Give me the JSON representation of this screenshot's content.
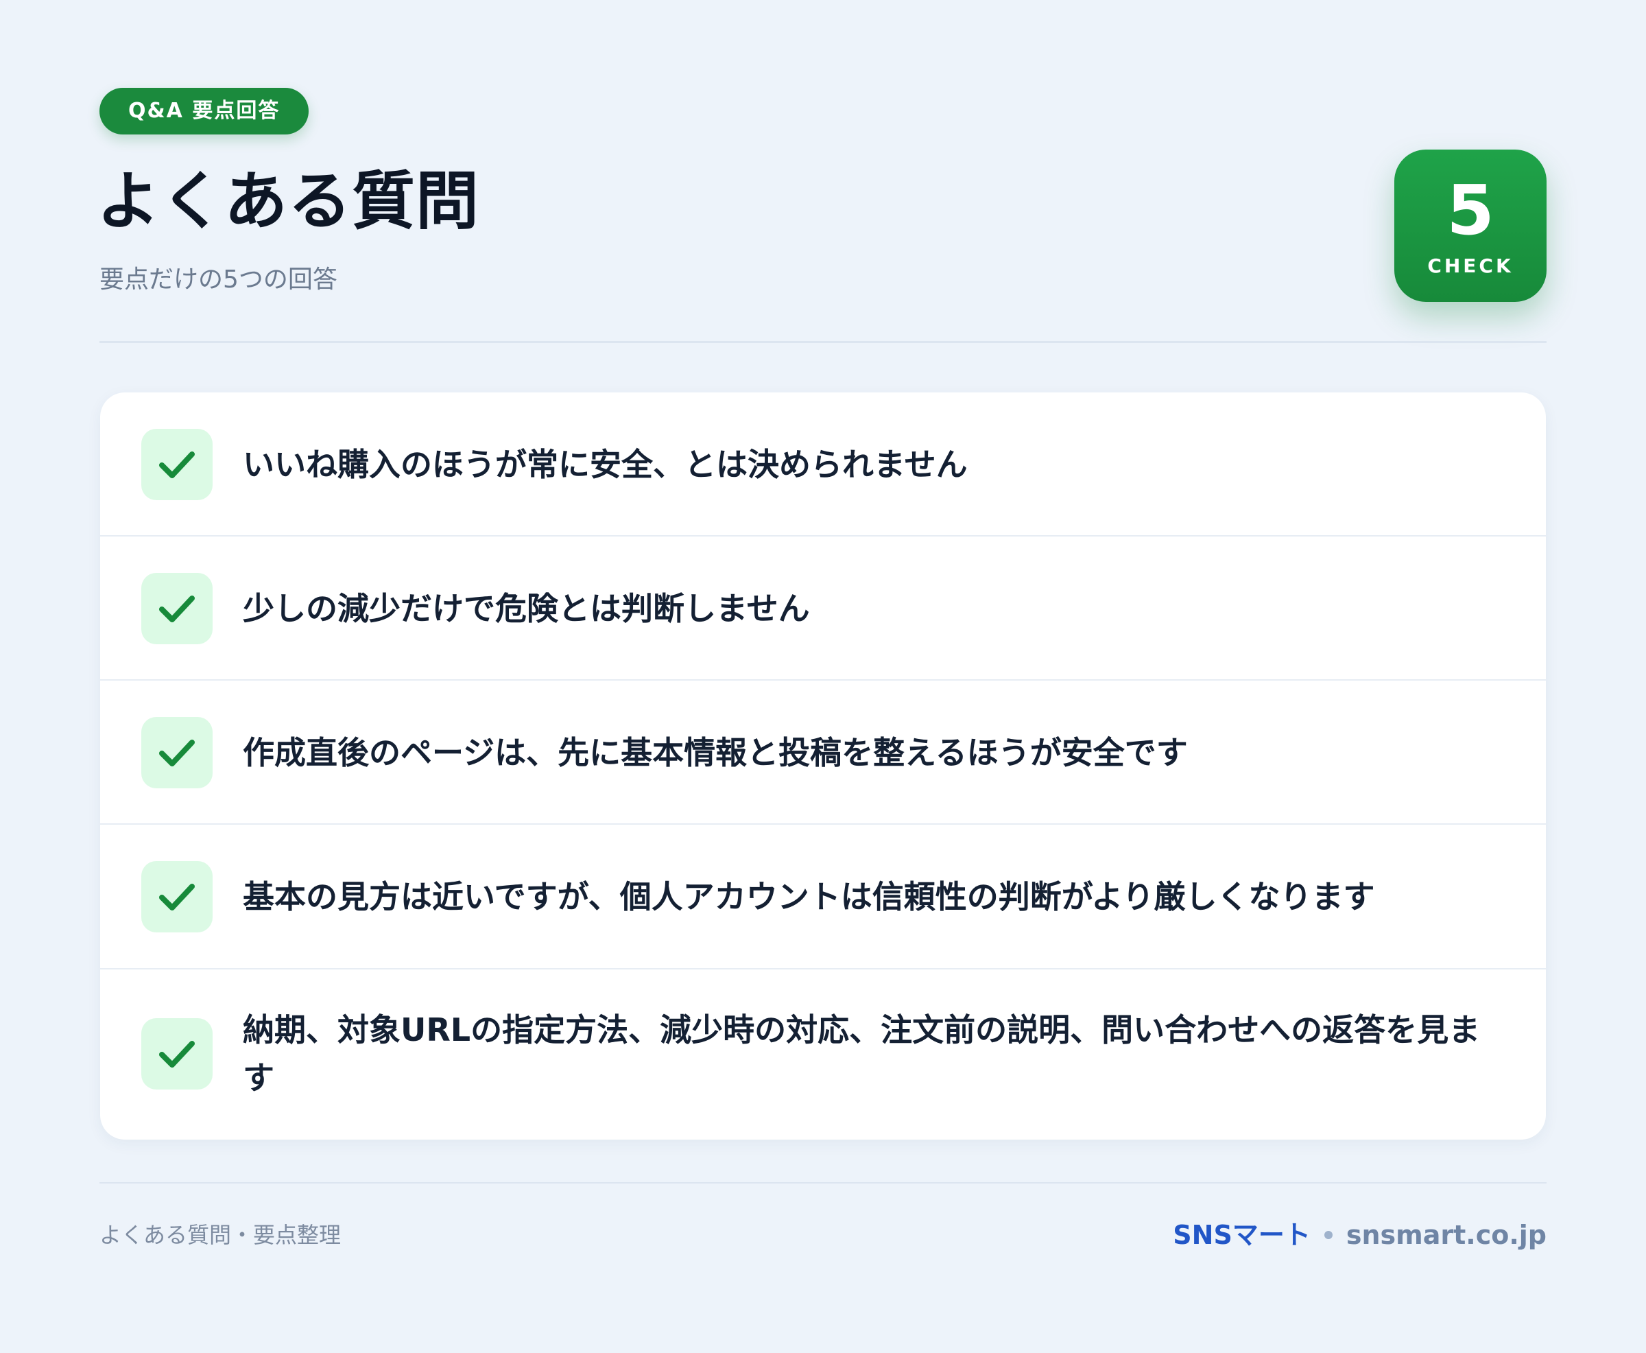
{
  "header": {
    "pill_label": "Q&A 要点回答",
    "title": "よくある質問",
    "subtitle": "要点だけの5つの回答"
  },
  "badge": {
    "number": "5",
    "label": "CHECK"
  },
  "faq": {
    "items": [
      {
        "text": "いいね購入のほうが常に安全、とは決められません"
      },
      {
        "text": "少しの減少だけで危険とは判断しません"
      },
      {
        "text": "作成直後のページは、先に基本情報と投稿を整えるほうが安全です"
      },
      {
        "text": "基本の見方は近いですが、個人アカウントは信頼性の判断がより厳しくなります"
      },
      {
        "text": "納期、対象URLの指定方法、減少時の対応、注文前の説明、問い合わせへの返答を見ます"
      }
    ]
  },
  "footer": {
    "left_text": "よくある質問・要点整理",
    "brand": "SNSマート",
    "domain": "snsmart.co.jp"
  },
  "colors": {
    "accent_green": "#1b8a3d",
    "check_bg": "#dcfae5",
    "brand_blue": "#2156c7",
    "background": "#edf3fa"
  },
  "icons": {
    "check": "check-icon"
  }
}
